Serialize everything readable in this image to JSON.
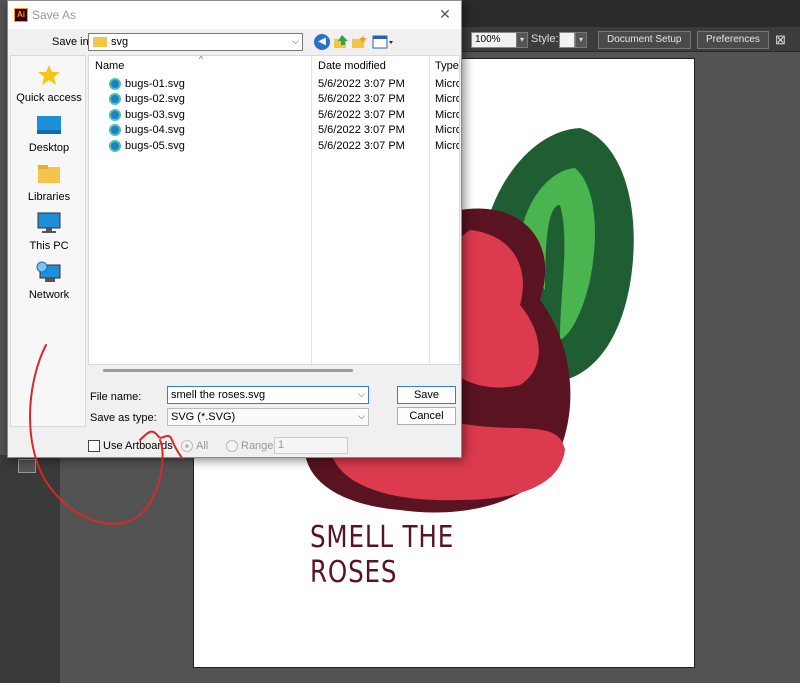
{
  "dialog": {
    "title": "Save As",
    "app_icon_text": "Ai",
    "close_glyph": "✕",
    "save_in_label": "Save in:",
    "save_in_value": "svg",
    "places": [
      {
        "label": "Quick access",
        "icon": "star-icon"
      },
      {
        "label": "Desktop",
        "icon": "desktop-icon"
      },
      {
        "label": "Libraries",
        "icon": "libraries-icon"
      },
      {
        "label": "This PC",
        "icon": "computer-icon"
      },
      {
        "label": "Network",
        "icon": "network-icon"
      }
    ],
    "columns": {
      "name": "Name",
      "date": "Date modified",
      "type": "Type"
    },
    "files": [
      {
        "name": "bugs-01.svg",
        "date": "5/6/2022 3:07 PM",
        "type": "Micro"
      },
      {
        "name": "bugs-02.svg",
        "date": "5/6/2022 3:07 PM",
        "type": "Micro"
      },
      {
        "name": "bugs-03.svg",
        "date": "5/6/2022 3:07 PM",
        "type": "Micro"
      },
      {
        "name": "bugs-04.svg",
        "date": "5/6/2022 3:07 PM",
        "type": "Micro"
      },
      {
        "name": "bugs-05.svg",
        "date": "5/6/2022 3:07 PM",
        "type": "Micro"
      }
    ],
    "file_name_label": "File name:",
    "file_name_value": "smell the roses.svg",
    "save_type_label": "Save as type:",
    "save_type_value": "SVG (*.SVG)",
    "save_button": "Save",
    "cancel_button": "Cancel",
    "use_artboards_label": "Use Artboards",
    "all_label": "All",
    "range_label": "Range:",
    "range_value": "1"
  },
  "illustrator": {
    "zoom_value": "100%",
    "style_label": "Style:",
    "document_setup_button": "Document Setup",
    "preferences_button": "Preferences",
    "artboard_caption": "SMELL THE ROSES"
  },
  "colors": {
    "rose_dark": "#5a1320",
    "rose_light": "#dc3a4e",
    "leaf_dark": "#1e5e32",
    "leaf_light": "#4ab54f",
    "annotation": "#d42a2a"
  }
}
